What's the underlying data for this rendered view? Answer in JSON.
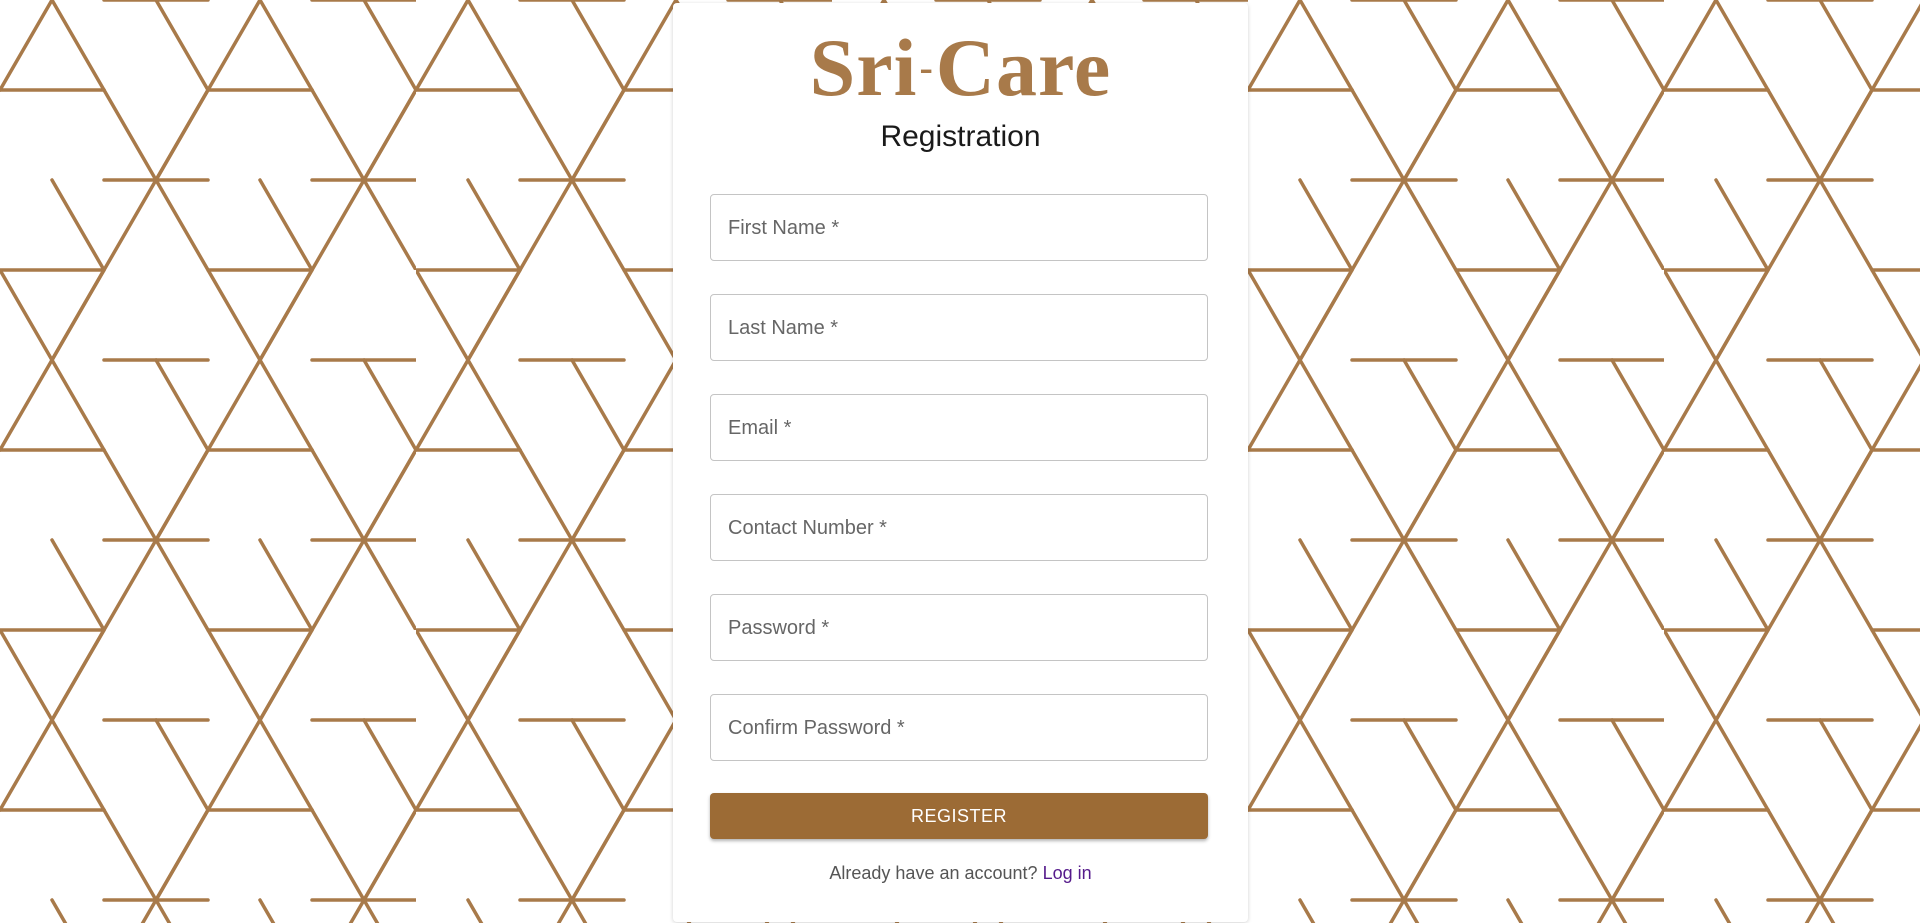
{
  "brand": {
    "logo_text_left": "Sri",
    "logo_separator": "-",
    "logo_text_right": "Care",
    "color": "#a87a4a"
  },
  "page_title": "Registration",
  "form": {
    "fields": [
      {
        "label": "First Name *",
        "value": ""
      },
      {
        "label": "Last Name *",
        "value": ""
      },
      {
        "label": "Email *",
        "value": ""
      },
      {
        "label": "Contact Number *",
        "value": ""
      },
      {
        "label": "Password *",
        "value": ""
      },
      {
        "label": "Confirm Password *",
        "value": ""
      }
    ],
    "register_label": "REGISTER",
    "register_color": "#9c6b35"
  },
  "footer": {
    "prompt": "Already have an account?",
    "login_link": "Log in",
    "link_color": "#551a8b"
  },
  "background": {
    "pattern": "geometric-hexagonal-lattice",
    "line_color": "#a87a4a"
  }
}
